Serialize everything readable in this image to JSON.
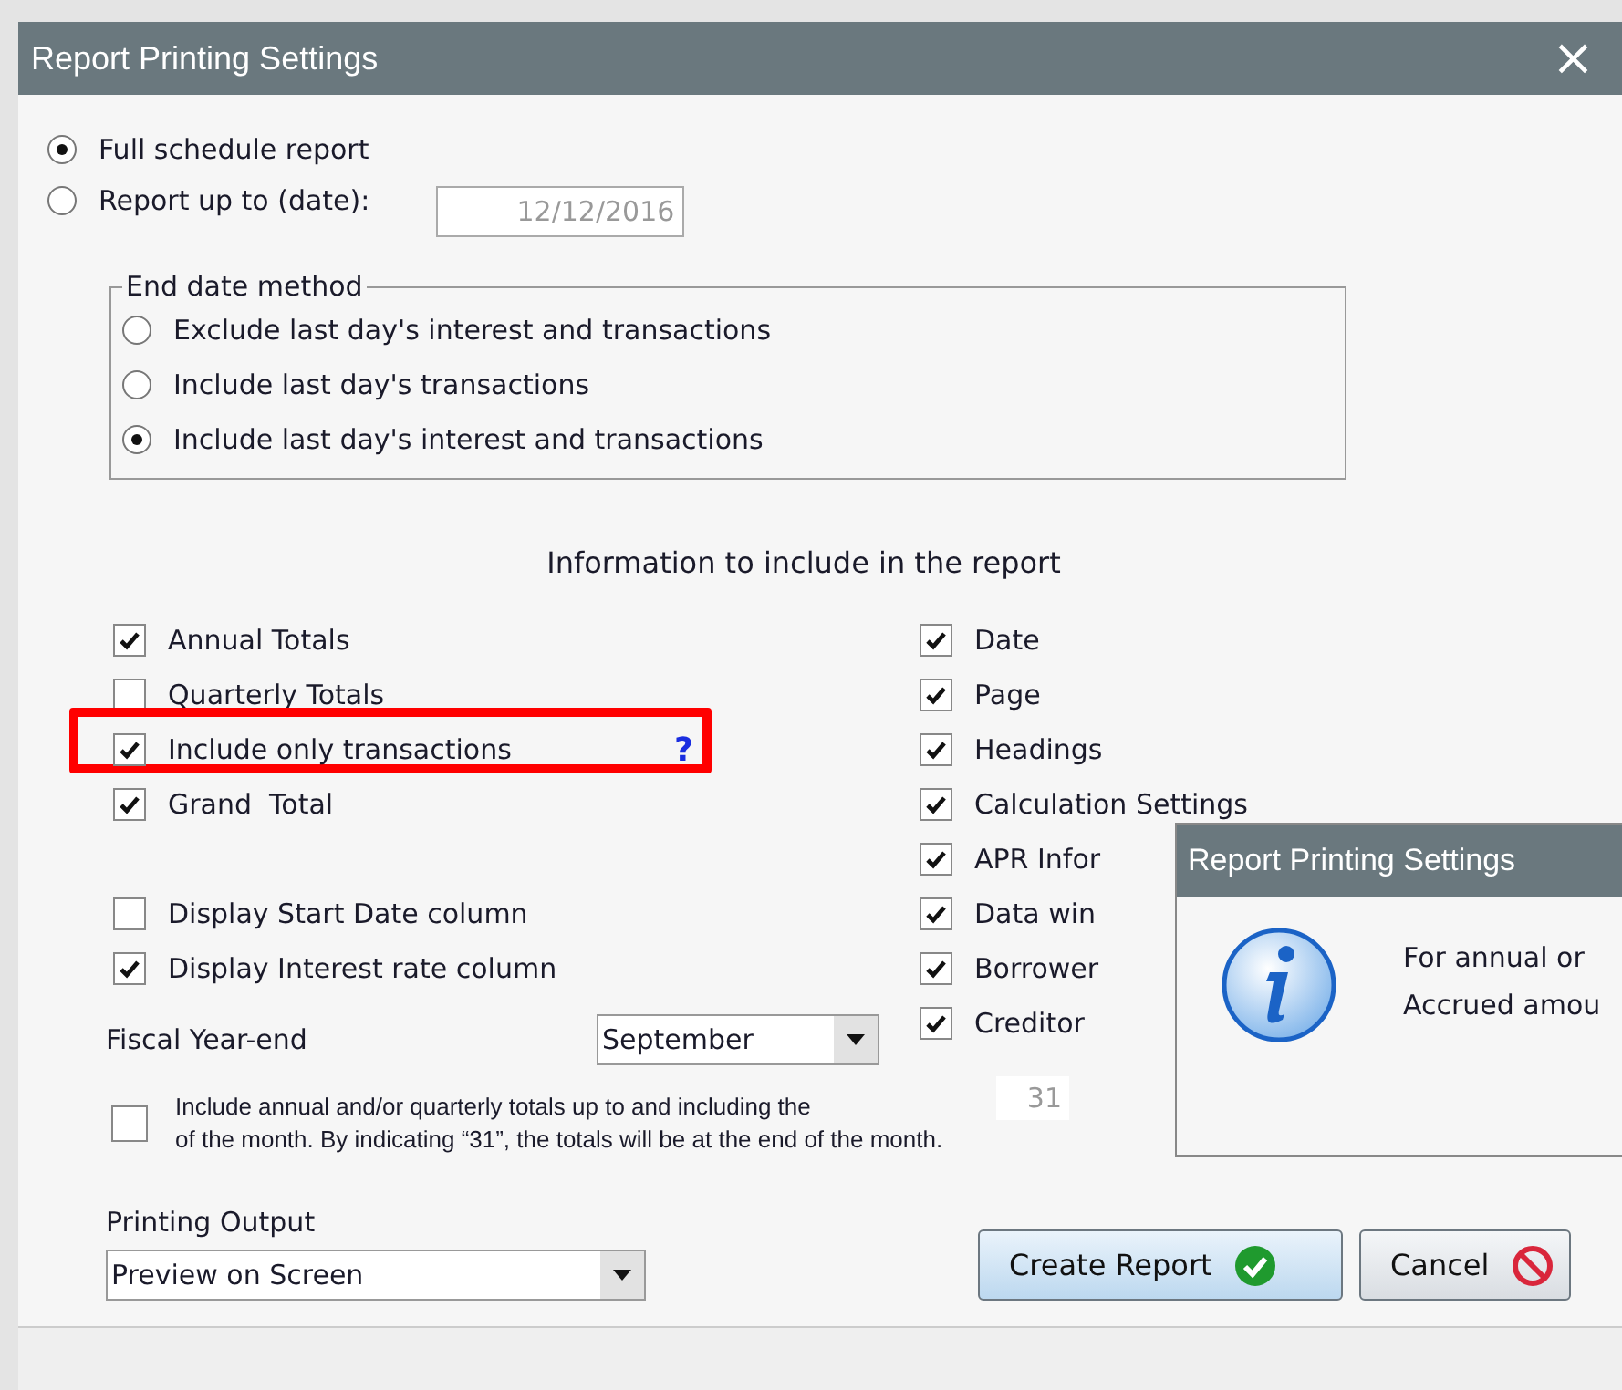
{
  "window": {
    "title": "Report Printing Settings",
    "close": "×"
  },
  "scope_options": [
    {
      "label": "Full schedule report",
      "selected": true
    },
    {
      "label": "Report up to (date):",
      "selected": false
    }
  ],
  "date_field": {
    "value": "12/12/2016",
    "disabled": true
  },
  "end_date_method": {
    "legend": "End date method",
    "options": [
      {
        "label": "Exclude last day's interest and transactions",
        "selected": false
      },
      {
        "label": "Include last day's transactions",
        "selected": false
      },
      {
        "label": "Include last day's interest and transactions",
        "selected": true
      }
    ]
  },
  "section_heading": "Information to include in the report",
  "left_checks": [
    {
      "label": "Annual Totals",
      "checked": true,
      "highlighted": false
    },
    {
      "label": "Quarterly Totals",
      "checked": false,
      "highlighted": false
    },
    {
      "label": "Include only transactions",
      "checked": true,
      "highlighted": true,
      "help": "?"
    },
    {
      "label": "Grand  Total",
      "checked": true,
      "highlighted": false
    }
  ],
  "column_checks": [
    {
      "label": "Display Start Date column",
      "checked": false
    },
    {
      "label": "Display Interest rate column",
      "checked": true
    }
  ],
  "right_checks": [
    {
      "label": "Date",
      "checked": true
    },
    {
      "label": "Page",
      "checked": true
    },
    {
      "label": "Headings",
      "checked": true
    },
    {
      "label": "Calculation Settings",
      "checked": true
    },
    {
      "label": "APR Infor",
      "checked": true
    },
    {
      "label": "Data win",
      "checked": true
    },
    {
      "label": "Borrower",
      "checked": true
    },
    {
      "label": "Creditor",
      "checked": true
    }
  ],
  "fiscal_year_end": {
    "label": "Fiscal Year-end",
    "value": "September"
  },
  "totals_day": {
    "checked": false,
    "text": "Include annual and/or quarterly totals up to and including the\nof the month. By indicating “31”, the totals will be at the end of the month.",
    "day": "31"
  },
  "printing_output": {
    "label": "Printing Output",
    "value": "Preview on Screen"
  },
  "buttons": [
    {
      "label": "Create Report",
      "kind": "ok"
    },
    {
      "label": "Cancel",
      "kind": "cancel"
    }
  ],
  "info_popup": {
    "title": "Report Printing Settings",
    "lines": [
      "For annual or",
      "Accrued amou"
    ]
  }
}
